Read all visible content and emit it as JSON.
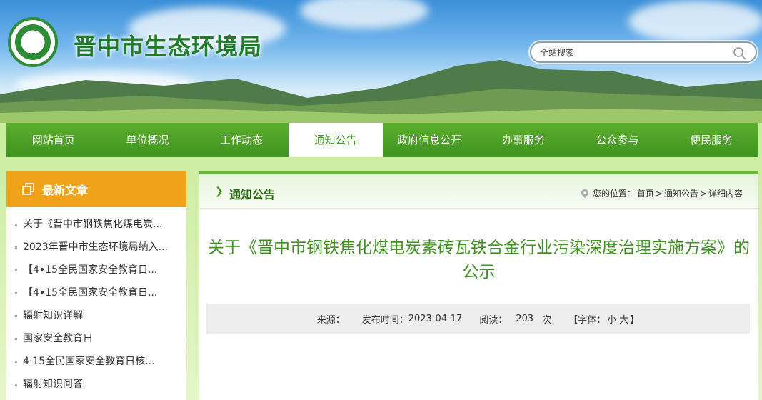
{
  "site": {
    "logo_text": "MEE",
    "title": "晋中市生态环境局"
  },
  "search": {
    "placeholder": "全站搜索",
    "icon": "search-icon"
  },
  "nav": {
    "items": [
      {
        "label": "网站首页"
      },
      {
        "label": "单位概况"
      },
      {
        "label": "工作动态"
      },
      {
        "label": "通知公告",
        "active": true
      },
      {
        "label": "政府信息公开"
      },
      {
        "label": "办事服务"
      },
      {
        "label": "公众参与"
      },
      {
        "label": "便民服务"
      }
    ]
  },
  "sidebar": {
    "title": "最新文章",
    "items": [
      {
        "label": "关于《晋中市钢铁焦化煤电炭..."
      },
      {
        "label": "2023年晋中市生态环境局纳入..."
      },
      {
        "label": "【4•15全民国家安全教育日..."
      },
      {
        "label": "【4•15全民国家安全教育日..."
      },
      {
        "label": "辐射知识详解"
      },
      {
        "label": "国家安全教育日"
      },
      {
        "label": "4·15全民国家安全教育日核..."
      },
      {
        "label": "辐射知识问答"
      }
    ]
  },
  "main": {
    "section_title": "通知公告",
    "breadcrumb": {
      "prefix": "您的位置：",
      "home": "首页",
      "sep1": ">",
      "section": "通知公告",
      "sep2": ">",
      "current": "详细内容"
    },
    "article_title": "关于《晋中市钢铁焦化煤电炭素砖瓦铁合金行业污染深度治理实施方案》的公示",
    "meta": {
      "source_label": "来源：",
      "date_label": "发布时间：",
      "date": "2023-04-17",
      "views_label": "阅读：",
      "views": "203",
      "views_unit": "次",
      "font_label": "【字体：",
      "font_small": "小",
      "font_large": "大",
      "font_close": "】"
    }
  },
  "colors": {
    "brand_green": "#3f9420",
    "accent_orange": "#f0a31a",
    "title_green": "#3f9420"
  }
}
